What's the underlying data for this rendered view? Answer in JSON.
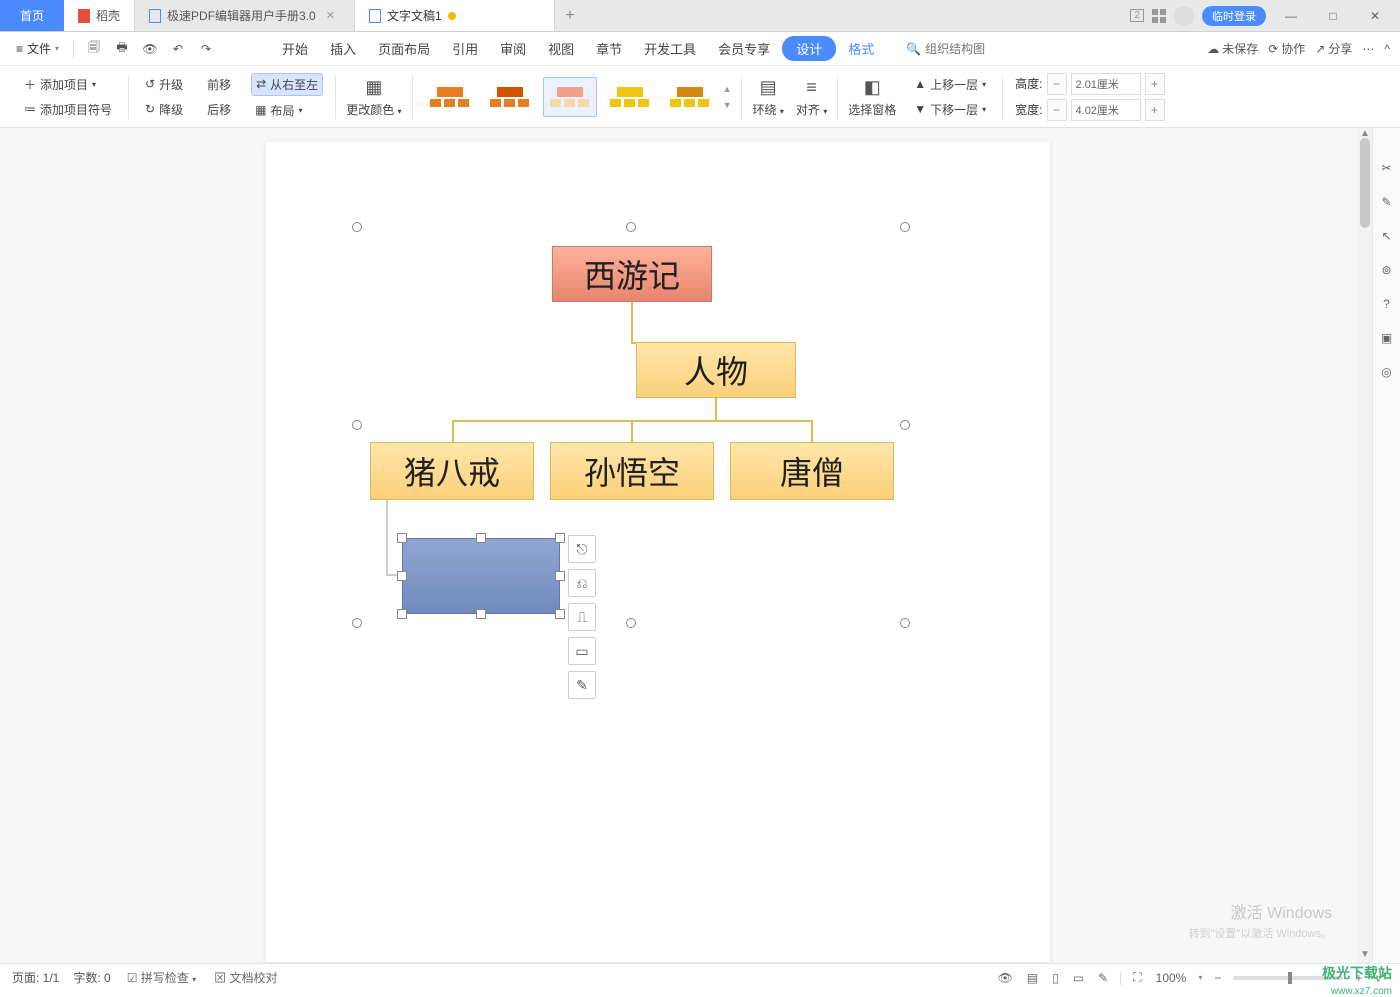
{
  "tabs": {
    "home": "首页",
    "dk": "稻壳",
    "pdf": "极速PDF编辑器用户手册3.0",
    "doc": "文字文稿1"
  },
  "titleRight": {
    "login": "临时登录"
  },
  "file": "文件",
  "menus": [
    "开始",
    "插入",
    "页面布局",
    "引用",
    "审阅",
    "视图",
    "章节",
    "开发工具",
    "会员专享"
  ],
  "design": "设计",
  "format": "格式",
  "search_ph": "组织结构图",
  "qaRight": {
    "unsaved": "未保存",
    "coop": "协作",
    "share": "分享"
  },
  "ribbon": {
    "addItem": "添加项目",
    "addBullet": "添加项目符号",
    "up": "升级",
    "down": "降级",
    "fwd": "前移",
    "back": "后移",
    "rtl": "从右至左",
    "layout": "布局",
    "changeColor": "更改颜色",
    "wrap": "环绕",
    "align": "对齐",
    "selPane": "选择窗格",
    "moveUp": "上移一层",
    "moveDown": "下移一层",
    "height": "高度:",
    "width": "宽度:",
    "hval": "2.01厘米",
    "wval": "4.02厘米"
  },
  "org": {
    "root": "西游记",
    "sub": "人物",
    "a": "猪八戒",
    "b": "孙悟空",
    "c": "唐僧"
  },
  "status": {
    "page": "页面: 1/1",
    "words": "字数: 0",
    "spell": "拼写检查",
    "compare": "文档校对",
    "zoom": "100%"
  },
  "watermark": "激活 Windows",
  "watermark2": "转到\"设置\"以激活 Windows。",
  "logo": "极光下载站",
  "logo2": "www.xz7.com"
}
